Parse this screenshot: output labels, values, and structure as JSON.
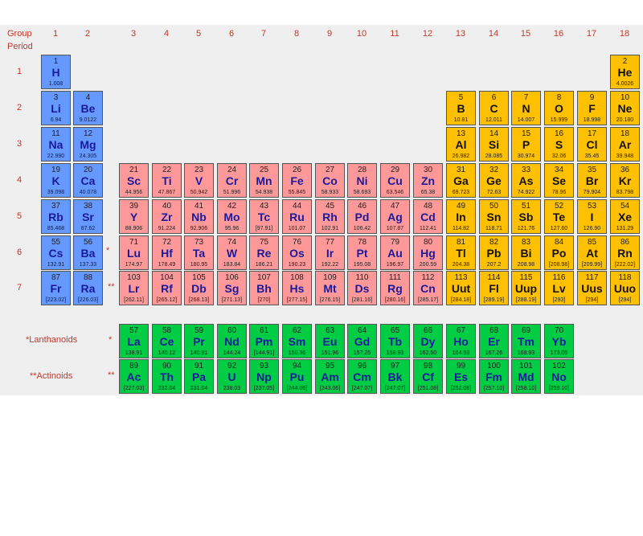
{
  "header": {
    "group_label": "Group",
    "period_label": "Period"
  },
  "groups": [
    "1",
    "2",
    "3",
    "4",
    "5",
    "6",
    "7",
    "8",
    "9",
    "10",
    "11",
    "12",
    "13",
    "14",
    "15",
    "16",
    "17",
    "18"
  ],
  "periods": [
    "1",
    "2",
    "3",
    "4",
    "5",
    "6",
    "7"
  ],
  "markers": {
    "lanthanoid_marker": "*",
    "actinoid_marker": "**"
  },
  "series_labels": {
    "lanthanoids": "*Lanthanoids",
    "actinoids": "**Actinoids"
  },
  "colors": {
    "s_block": "#6699ff",
    "p_block": "#ffc000",
    "d_block": "#ff9999",
    "f_block": "#00cc44"
  },
  "elements": [
    {
      "n": "1",
      "s": "H",
      "m": "1.008",
      "g": 1,
      "p": 1,
      "b": "s"
    },
    {
      "n": "2",
      "s": "He",
      "m": "4.0026",
      "g": 18,
      "p": 1,
      "b": "p"
    },
    {
      "n": "3",
      "s": "Li",
      "m": "6.94",
      "g": 1,
      "p": 2,
      "b": "s"
    },
    {
      "n": "4",
      "s": "Be",
      "m": "9.0122",
      "g": 2,
      "p": 2,
      "b": "s"
    },
    {
      "n": "5",
      "s": "B",
      "m": "10.81",
      "g": 13,
      "p": 2,
      "b": "p"
    },
    {
      "n": "6",
      "s": "C",
      "m": "12.011",
      "g": 14,
      "p": 2,
      "b": "p"
    },
    {
      "n": "7",
      "s": "N",
      "m": "14.007",
      "g": 15,
      "p": 2,
      "b": "p"
    },
    {
      "n": "8",
      "s": "O",
      "m": "15.999",
      "g": 16,
      "p": 2,
      "b": "p"
    },
    {
      "n": "9",
      "s": "F",
      "m": "18.998",
      "g": 17,
      "p": 2,
      "b": "p"
    },
    {
      "n": "10",
      "s": "Ne",
      "m": "20.180",
      "g": 18,
      "p": 2,
      "b": "p"
    },
    {
      "n": "11",
      "s": "Na",
      "m": "22.990",
      "g": 1,
      "p": 3,
      "b": "s"
    },
    {
      "n": "12",
      "s": "Mg",
      "m": "24.305",
      "g": 2,
      "p": 3,
      "b": "s"
    },
    {
      "n": "13",
      "s": "Al",
      "m": "26.982",
      "g": 13,
      "p": 3,
      "b": "p"
    },
    {
      "n": "14",
      "s": "Si",
      "m": "28.085",
      "g": 14,
      "p": 3,
      "b": "p"
    },
    {
      "n": "15",
      "s": "P",
      "m": "30.974",
      "g": 15,
      "p": 3,
      "b": "p"
    },
    {
      "n": "16",
      "s": "S",
      "m": "32.06",
      "g": 16,
      "p": 3,
      "b": "p"
    },
    {
      "n": "17",
      "s": "Cl",
      "m": "35.45",
      "g": 17,
      "p": 3,
      "b": "p"
    },
    {
      "n": "18",
      "s": "Ar",
      "m": "39.948",
      "g": 18,
      "p": 3,
      "b": "p"
    },
    {
      "n": "19",
      "s": "K",
      "m": "39.098",
      "g": 1,
      "p": 4,
      "b": "s"
    },
    {
      "n": "20",
      "s": "Ca",
      "m": "40.078",
      "g": 2,
      "p": 4,
      "b": "s"
    },
    {
      "n": "21",
      "s": "Sc",
      "m": "44.956",
      "g": 3,
      "p": 4,
      "b": "d"
    },
    {
      "n": "22",
      "s": "Ti",
      "m": "47.867",
      "g": 4,
      "p": 4,
      "b": "d"
    },
    {
      "n": "23",
      "s": "V",
      "m": "50.942",
      "g": 5,
      "p": 4,
      "b": "d"
    },
    {
      "n": "24",
      "s": "Cr",
      "m": "51.996",
      "g": 6,
      "p": 4,
      "b": "d"
    },
    {
      "n": "25",
      "s": "Mn",
      "m": "54.938",
      "g": 7,
      "p": 4,
      "b": "d"
    },
    {
      "n": "26",
      "s": "Fe",
      "m": "55.845",
      "g": 8,
      "p": 4,
      "b": "d"
    },
    {
      "n": "27",
      "s": "Co",
      "m": "58.933",
      "g": 9,
      "p": 4,
      "b": "d"
    },
    {
      "n": "28",
      "s": "Ni",
      "m": "58.693",
      "g": 10,
      "p": 4,
      "b": "d"
    },
    {
      "n": "29",
      "s": "Cu",
      "m": "63.546",
      "g": 11,
      "p": 4,
      "b": "d"
    },
    {
      "n": "30",
      "s": "Zn",
      "m": "65.38",
      "g": 12,
      "p": 4,
      "b": "d"
    },
    {
      "n": "31",
      "s": "Ga",
      "m": "69.723",
      "g": 13,
      "p": 4,
      "b": "p"
    },
    {
      "n": "32",
      "s": "Ge",
      "m": "72.63",
      "g": 14,
      "p": 4,
      "b": "p"
    },
    {
      "n": "33",
      "s": "As",
      "m": "74.922",
      "g": 15,
      "p": 4,
      "b": "p"
    },
    {
      "n": "34",
      "s": "Se",
      "m": "78.96",
      "g": 16,
      "p": 4,
      "b": "p"
    },
    {
      "n": "35",
      "s": "Br",
      "m": "79.904",
      "g": 17,
      "p": 4,
      "b": "p"
    },
    {
      "n": "36",
      "s": "Kr",
      "m": "83.798",
      "g": 18,
      "p": 4,
      "b": "p"
    },
    {
      "n": "37",
      "s": "Rb",
      "m": "85.468",
      "g": 1,
      "p": 5,
      "b": "s"
    },
    {
      "n": "38",
      "s": "Sr",
      "m": "87.62",
      "g": 2,
      "p": 5,
      "b": "s"
    },
    {
      "n": "39",
      "s": "Y",
      "m": "88.906",
      "g": 3,
      "p": 5,
      "b": "d"
    },
    {
      "n": "40",
      "s": "Zr",
      "m": "91.224",
      "g": 4,
      "p": 5,
      "b": "d"
    },
    {
      "n": "41",
      "s": "Nb",
      "m": "92.906",
      "g": 5,
      "p": 5,
      "b": "d"
    },
    {
      "n": "42",
      "s": "Mo",
      "m": "95.96",
      "g": 6,
      "p": 5,
      "b": "d"
    },
    {
      "n": "43",
      "s": "Tc",
      "m": "[97.91]",
      "g": 7,
      "p": 5,
      "b": "d"
    },
    {
      "n": "44",
      "s": "Ru",
      "m": "101.07",
      "g": 8,
      "p": 5,
      "b": "d"
    },
    {
      "n": "45",
      "s": "Rh",
      "m": "102.91",
      "g": 9,
      "p": 5,
      "b": "d"
    },
    {
      "n": "46",
      "s": "Pd",
      "m": "106.42",
      "g": 10,
      "p": 5,
      "b": "d"
    },
    {
      "n": "47",
      "s": "Ag",
      "m": "107.87",
      "g": 11,
      "p": 5,
      "b": "d"
    },
    {
      "n": "48",
      "s": "Cd",
      "m": "112.41",
      "g": 12,
      "p": 5,
      "b": "d"
    },
    {
      "n": "49",
      "s": "In",
      "m": "114.82",
      "g": 13,
      "p": 5,
      "b": "p"
    },
    {
      "n": "50",
      "s": "Sn",
      "m": "118.71",
      "g": 14,
      "p": 5,
      "b": "p"
    },
    {
      "n": "51",
      "s": "Sb",
      "m": "121.76",
      "g": 15,
      "p": 5,
      "b": "p"
    },
    {
      "n": "52",
      "s": "Te",
      "m": "127.60",
      "g": 16,
      "p": 5,
      "b": "p"
    },
    {
      "n": "53",
      "s": "I",
      "m": "126.90",
      "g": 17,
      "p": 5,
      "b": "p"
    },
    {
      "n": "54",
      "s": "Xe",
      "m": "131.29",
      "g": 18,
      "p": 5,
      "b": "p"
    },
    {
      "n": "55",
      "s": "Cs",
      "m": "132.91",
      "g": 1,
      "p": 6,
      "b": "s"
    },
    {
      "n": "56",
      "s": "Ba",
      "m": "137.33",
      "g": 2,
      "p": 6,
      "b": "s"
    },
    {
      "n": "71",
      "s": "Lu",
      "m": "174.97",
      "g": 3,
      "p": 6,
      "b": "d"
    },
    {
      "n": "72",
      "s": "Hf",
      "m": "178.49",
      "g": 4,
      "p": 6,
      "b": "d"
    },
    {
      "n": "73",
      "s": "Ta",
      "m": "180.95",
      "g": 5,
      "p": 6,
      "b": "d"
    },
    {
      "n": "74",
      "s": "W",
      "m": "183.84",
      "g": 6,
      "p": 6,
      "b": "d"
    },
    {
      "n": "75",
      "s": "Re",
      "m": "186.21",
      "g": 7,
      "p": 6,
      "b": "d"
    },
    {
      "n": "76",
      "s": "Os",
      "m": "190.23",
      "g": 8,
      "p": 6,
      "b": "d"
    },
    {
      "n": "77",
      "s": "Ir",
      "m": "192.22",
      "g": 9,
      "p": 6,
      "b": "d"
    },
    {
      "n": "78",
      "s": "Pt",
      "m": "195.08",
      "g": 10,
      "p": 6,
      "b": "d"
    },
    {
      "n": "79",
      "s": "Au",
      "m": "196.97",
      "g": 11,
      "p": 6,
      "b": "d"
    },
    {
      "n": "80",
      "s": "Hg",
      "m": "200.59",
      "g": 12,
      "p": 6,
      "b": "d"
    },
    {
      "n": "81",
      "s": "Tl",
      "m": "204.38",
      "g": 13,
      "p": 6,
      "b": "p"
    },
    {
      "n": "82",
      "s": "Pb",
      "m": "207.2",
      "g": 14,
      "p": 6,
      "b": "p"
    },
    {
      "n": "83",
      "s": "Bi",
      "m": "208.98",
      "g": 15,
      "p": 6,
      "b": "p"
    },
    {
      "n": "84",
      "s": "Po",
      "m": "[208.98]",
      "g": 16,
      "p": 6,
      "b": "p"
    },
    {
      "n": "85",
      "s": "At",
      "m": "[209.99]",
      "g": 17,
      "p": 6,
      "b": "p"
    },
    {
      "n": "86",
      "s": "Rn",
      "m": "[222.02]",
      "g": 18,
      "p": 6,
      "b": "p"
    },
    {
      "n": "87",
      "s": "Fr",
      "m": "[223.02]",
      "g": 1,
      "p": 7,
      "b": "s"
    },
    {
      "n": "88",
      "s": "Ra",
      "m": "[226.03]",
      "g": 2,
      "p": 7,
      "b": "s"
    },
    {
      "n": "103",
      "s": "Lr",
      "m": "[262.11]",
      "g": 3,
      "p": 7,
      "b": "d"
    },
    {
      "n": "104",
      "s": "Rf",
      "m": "[265.12]",
      "g": 4,
      "p": 7,
      "b": "d"
    },
    {
      "n": "105",
      "s": "Db",
      "m": "[268.13]",
      "g": 5,
      "p": 7,
      "b": "d"
    },
    {
      "n": "106",
      "s": "Sg",
      "m": "[271.13]",
      "g": 6,
      "p": 7,
      "b": "d"
    },
    {
      "n": "107",
      "s": "Bh",
      "m": "[270]",
      "g": 7,
      "p": 7,
      "b": "d"
    },
    {
      "n": "108",
      "s": "Hs",
      "m": "[277.15]",
      "g": 8,
      "p": 7,
      "b": "d"
    },
    {
      "n": "109",
      "s": "Mt",
      "m": "[276.15]",
      "g": 9,
      "p": 7,
      "b": "d"
    },
    {
      "n": "110",
      "s": "Ds",
      "m": "[281.16]",
      "g": 10,
      "p": 7,
      "b": "d"
    },
    {
      "n": "111",
      "s": "Rg",
      "m": "[280.16]",
      "g": 11,
      "p": 7,
      "b": "d"
    },
    {
      "n": "112",
      "s": "Cn",
      "m": "[285.17]",
      "g": 12,
      "p": 7,
      "b": "d"
    },
    {
      "n": "113",
      "s": "Uut",
      "m": "[284.18]",
      "g": 13,
      "p": 7,
      "b": "p"
    },
    {
      "n": "114",
      "s": "Fl",
      "m": "[289.19]",
      "g": 14,
      "p": 7,
      "b": "p"
    },
    {
      "n": "115",
      "s": "Uup",
      "m": "[288.19]",
      "g": 15,
      "p": 7,
      "b": "p"
    },
    {
      "n": "116",
      "s": "Lv",
      "m": "[293]",
      "g": 16,
      "p": 7,
      "b": "p"
    },
    {
      "n": "117",
      "s": "Uus",
      "m": "[294]",
      "g": 17,
      "p": 7,
      "b": "p"
    },
    {
      "n": "118",
      "s": "Uuo",
      "m": "[294]",
      "g": 18,
      "p": 7,
      "b": "p"
    },
    {
      "n": "57",
      "s": "La",
      "m": "138.91",
      "g": 3,
      "p": "L",
      "b": "f"
    },
    {
      "n": "58",
      "s": "Ce",
      "m": "140.12",
      "g": 4,
      "p": "L",
      "b": "f"
    },
    {
      "n": "59",
      "s": "Pr",
      "m": "140.91",
      "g": 5,
      "p": "L",
      "b": "f"
    },
    {
      "n": "60",
      "s": "Nd",
      "m": "144.24",
      "g": 6,
      "p": "L",
      "b": "f"
    },
    {
      "n": "61",
      "s": "Pm",
      "m": "[144.91]",
      "g": 7,
      "p": "L",
      "b": "f"
    },
    {
      "n": "62",
      "s": "Sm",
      "m": "150.36",
      "g": 8,
      "p": "L",
      "b": "f"
    },
    {
      "n": "63",
      "s": "Eu",
      "m": "151.96",
      "g": 9,
      "p": "L",
      "b": "f"
    },
    {
      "n": "64",
      "s": "Gd",
      "m": "157.25",
      "g": 10,
      "p": "L",
      "b": "f"
    },
    {
      "n": "65",
      "s": "Tb",
      "m": "158.93",
      "g": 11,
      "p": "L",
      "b": "f"
    },
    {
      "n": "66",
      "s": "Dy",
      "m": "162.50",
      "g": 12,
      "p": "L",
      "b": "f"
    },
    {
      "n": "67",
      "s": "Ho",
      "m": "164.93",
      "g": 13,
      "p": "L",
      "b": "f"
    },
    {
      "n": "68",
      "s": "Er",
      "m": "167.26",
      "g": 14,
      "p": "L",
      "b": "f"
    },
    {
      "n": "69",
      "s": "Tm",
      "m": "168.93",
      "g": 15,
      "p": "L",
      "b": "f"
    },
    {
      "n": "70",
      "s": "Yb",
      "m": "173.05",
      "g": 16,
      "p": "L",
      "b": "f"
    },
    {
      "n": "89",
      "s": "Ac",
      "m": "[227.03]",
      "g": 3,
      "p": "A",
      "b": "f"
    },
    {
      "n": "90",
      "s": "Th",
      "m": "232.04",
      "g": 4,
      "p": "A",
      "b": "f"
    },
    {
      "n": "91",
      "s": "Pa",
      "m": "231.04",
      "g": 5,
      "p": "A",
      "b": "f"
    },
    {
      "n": "92",
      "s": "U",
      "m": "238.03",
      "g": 6,
      "p": "A",
      "b": "f"
    },
    {
      "n": "93",
      "s": "Np",
      "m": "[237.05]",
      "g": 7,
      "p": "A",
      "b": "f"
    },
    {
      "n": "94",
      "s": "Pu",
      "m": "[244.06]",
      "g": 8,
      "p": "A",
      "b": "f"
    },
    {
      "n": "95",
      "s": "Am",
      "m": "[243.06]",
      "g": 9,
      "p": "A",
      "b": "f"
    },
    {
      "n": "96",
      "s": "Cm",
      "m": "[247.07]",
      "g": 10,
      "p": "A",
      "b": "f"
    },
    {
      "n": "97",
      "s": "Bk",
      "m": "[247.07]",
      "g": 11,
      "p": "A",
      "b": "f"
    },
    {
      "n": "98",
      "s": "Cf",
      "m": "[251.08]",
      "g": 12,
      "p": "A",
      "b": "f"
    },
    {
      "n": "99",
      "s": "Es",
      "m": "[252.08]",
      "g": 13,
      "p": "A",
      "b": "f"
    },
    {
      "n": "100",
      "s": "Fm",
      "m": "[257.10]",
      "g": 14,
      "p": "A",
      "b": "f"
    },
    {
      "n": "101",
      "s": "Md",
      "m": "[258.10]",
      "g": 15,
      "p": "A",
      "b": "f"
    },
    {
      "n": "102",
      "s": "No",
      "m": "[259.10]",
      "g": 16,
      "p": "A",
      "b": "f"
    }
  ]
}
